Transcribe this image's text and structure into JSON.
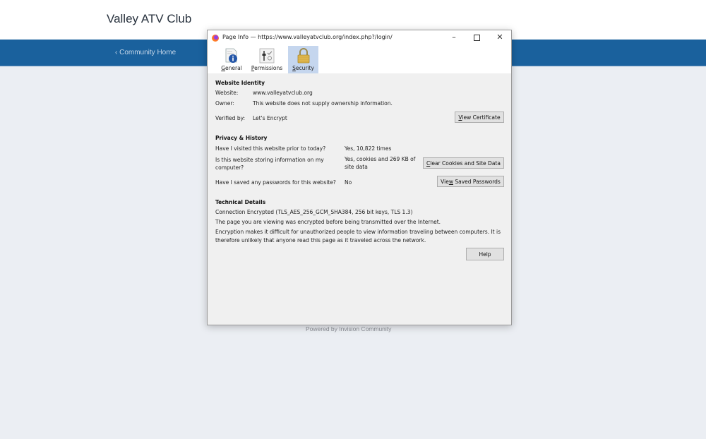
{
  "site": {
    "title": "Valley ATV Club",
    "nav_link": "‹ Community Home",
    "footer": "Powered by Invision Community",
    "colors": {
      "nav_bar": "#1a619d",
      "page_bg": "#ebeef3"
    }
  },
  "dialog": {
    "title": "Page Info — https://www.valleyatvclub.org/index.php?/login/",
    "window_buttons": {
      "minimize": "–",
      "maximize": "□",
      "close": "✕"
    },
    "tabs": [
      {
        "name": "general",
        "pre": "",
        "acc": "G",
        "post": "eneral",
        "icon": "info-document-icon",
        "selected": false
      },
      {
        "name": "permissions",
        "pre": "",
        "acc": "P",
        "post": "ermissions",
        "icon": "permissions-sliders-icon",
        "selected": false
      },
      {
        "name": "security",
        "pre": "",
        "acc": "S",
        "post": "ecurity",
        "icon": "padlock-icon",
        "selected": true
      }
    ],
    "identity": {
      "heading": "Website Identity",
      "website_label": "Website:",
      "website_value": "www.valleyatvclub.org",
      "owner_label": "Owner:",
      "owner_value": "This website does not supply ownership information.",
      "verified_label": "Verified by:",
      "verified_value": "Let's Encrypt",
      "view_cert": {
        "pre": "",
        "acc": "V",
        "post": "iew Certificate"
      }
    },
    "privacy": {
      "heading": "Privacy & History",
      "visited_q": "Have I visited this website prior to today?",
      "visited_a": "Yes, 10,822 times",
      "storing_q1": "Is this website storing information on my",
      "storing_q2": "computer?",
      "storing_a1": "Yes, cookies and 269 KB of",
      "storing_a2": "site data",
      "clear_btn": {
        "pre": "",
        "acc": "C",
        "post": "lear Cookies and Site Data"
      },
      "passwords_q": "Have I saved any passwords for this website?",
      "passwords_a": "No",
      "passwords_btn": {
        "pre": "Vie",
        "acc": "w",
        "post": " Saved Passwords"
      }
    },
    "technical": {
      "heading": "Technical Details",
      "line1": "Connection Encrypted (TLS_AES_256_GCM_SHA384, 256 bit keys, TLS 1.3)",
      "line2": "The page you are viewing was encrypted before being transmitted over the Internet.",
      "line3a": "Encryption makes it difficult for unauthorized people to view information traveling between computers. It is",
      "line3b": "therefore unlikely that anyone read this page as it traveled across the network.",
      "help_btn": "Help"
    }
  }
}
